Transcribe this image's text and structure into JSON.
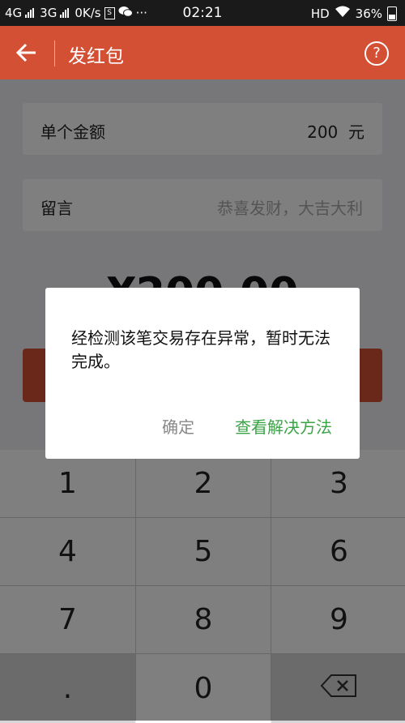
{
  "status_bar": {
    "net1": "4G",
    "net2": "3G",
    "speed": "0K/s",
    "box_icon_letter": "S",
    "dots": "···",
    "time": "02:21",
    "hd": "HD",
    "battery": "36%"
  },
  "title_bar": {
    "title": "发红包",
    "help": "?",
    "accent_color": "#d45035"
  },
  "form": {
    "amount_label": "单个金额",
    "amount_value": "200",
    "amount_unit": "元",
    "message_label": "留言",
    "message_placeholder": "恭喜发财，大吉大利",
    "total": "¥200.00"
  },
  "keypad": {
    "keys": [
      "1",
      "2",
      "3",
      "4",
      "5",
      "6",
      "7",
      "8",
      "9",
      ".",
      "0"
    ],
    "delete_icon": "backspace-icon"
  },
  "dialog": {
    "message": "经检测该笔交易存在异常，暂时无法完成。",
    "confirm_label": "确定",
    "solution_label": "查看解决方法",
    "solution_color": "#3aa447"
  }
}
